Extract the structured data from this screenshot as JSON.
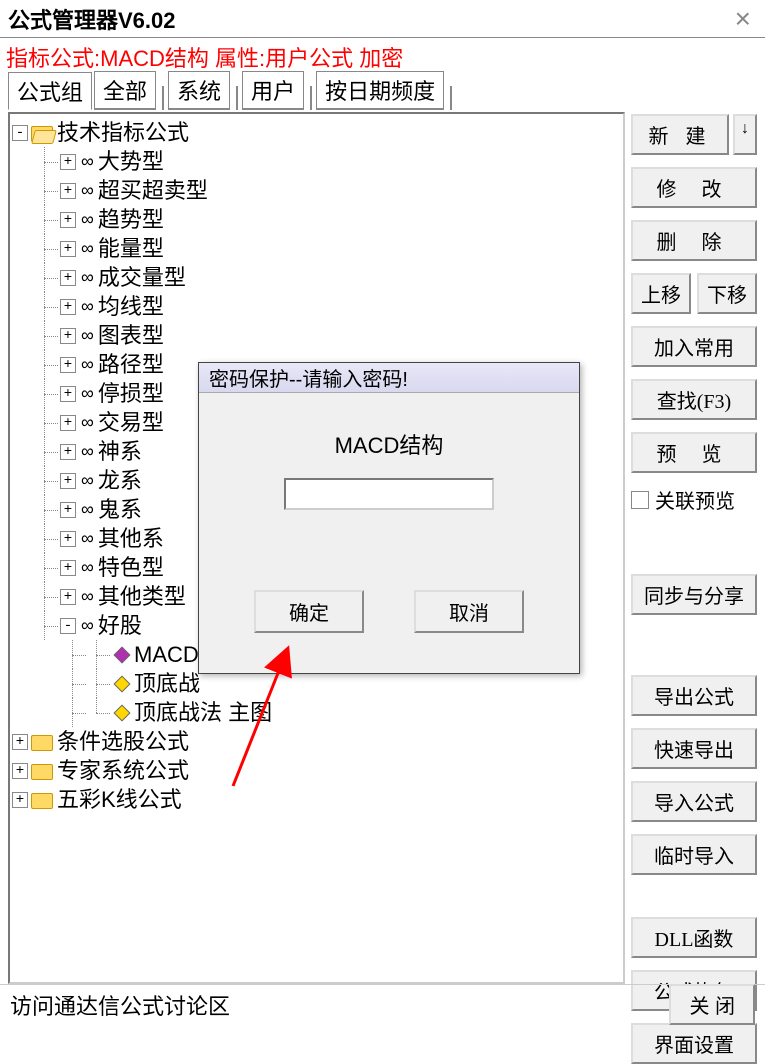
{
  "window": {
    "title": "公式管理器V6.02",
    "info_line": "指标公式:MACD结构 属性:用户公式 加密"
  },
  "tabs": [
    "公式组",
    "全部",
    "系统",
    "用户",
    "按日期频度"
  ],
  "active_tab": 0,
  "tree": {
    "root1": {
      "label": "技术指标公式",
      "expanded": true
    },
    "root1_children": [
      "大势型",
      "超买超卖型",
      "趋势型",
      "能量型",
      "成交量型",
      "均线型",
      "图表型",
      "路径型",
      "停损型",
      "交易型",
      "神系",
      "龙系",
      "鬼系",
      "其他系",
      "特色型",
      "其他类型"
    ],
    "haogu": {
      "label": "好股",
      "expanded": true
    },
    "haogu_children": [
      {
        "label": "MACD结",
        "icon": "purple"
      },
      {
        "label": "顶底战",
        "icon": "yellow"
      },
      {
        "label": "顶底战法 主图",
        "icon": "yellow"
      }
    ],
    "root2": "条件选股公式",
    "root3": "专家系统公式",
    "root4": "五彩K线公式"
  },
  "buttons": {
    "new": "新 建",
    "modify": "修 改",
    "delete": "删 除",
    "move_up": "上移",
    "move_down": "下移",
    "add_fav": "加入常用",
    "find": "查找(F3)",
    "preview": "预 览",
    "link_preview": "关联预览",
    "sync_share": "同步与分享",
    "export": "导出公式",
    "quick_export": "快速导出",
    "import": "导入公式",
    "temp_import": "临时导入",
    "dll": "DLL函数",
    "restore": "公式恢复",
    "ui_settings": "界面设置",
    "close": "关 闭"
  },
  "bottom_link": "访问通达信公式讨论区",
  "dialog": {
    "title": "密码保护--请输入密码!",
    "label": "MACD结构",
    "ok": "确定",
    "cancel": "取消"
  }
}
